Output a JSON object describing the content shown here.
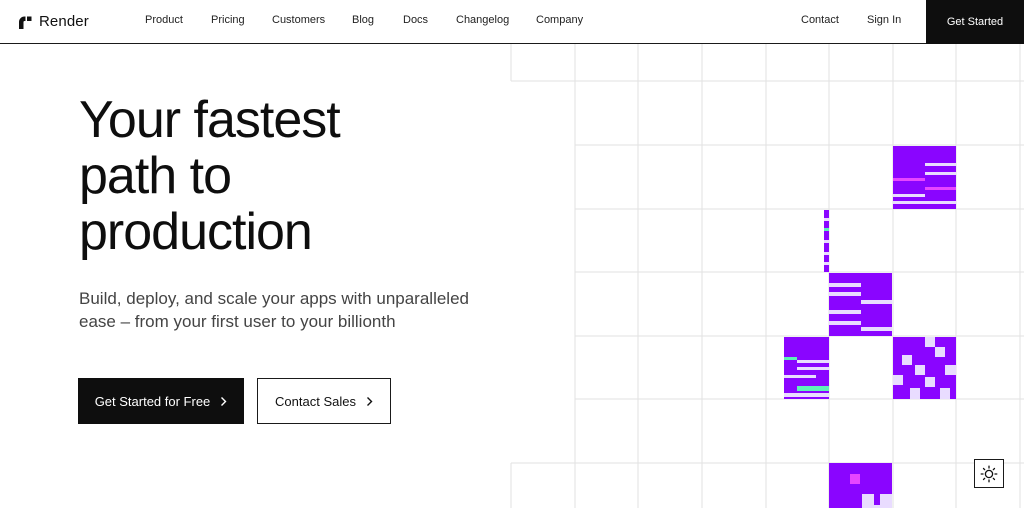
{
  "brand": {
    "name": "Render",
    "icon": "render-logo-icon"
  },
  "nav": {
    "items": [
      "Product",
      "Pricing",
      "Customers",
      "Blog",
      "Docs",
      "Changelog",
      "Company"
    ],
    "right": [
      "Contact",
      "Sign In"
    ],
    "cta": "Get Started"
  },
  "hero": {
    "title_lines": [
      "Your fastest",
      "path to",
      "production"
    ],
    "subtitle_lines": [
      "Build, deploy, and scale your apps with unparalleled",
      "ease – from your first user to your billionth"
    ],
    "primary_button": "Get Started for Free",
    "secondary_button": "Contact Sales"
  },
  "theme_toggle": {
    "icon": "sun-icon"
  },
  "colors": {
    "text": "#0e0e0e",
    "subtext": "#444444",
    "accent_purple": "#8a05ff",
    "pale_lavender": "#e9dcff",
    "pink": "#e646ff",
    "mint": "#5cf2b7",
    "grid_line": "#e2e2e2"
  }
}
